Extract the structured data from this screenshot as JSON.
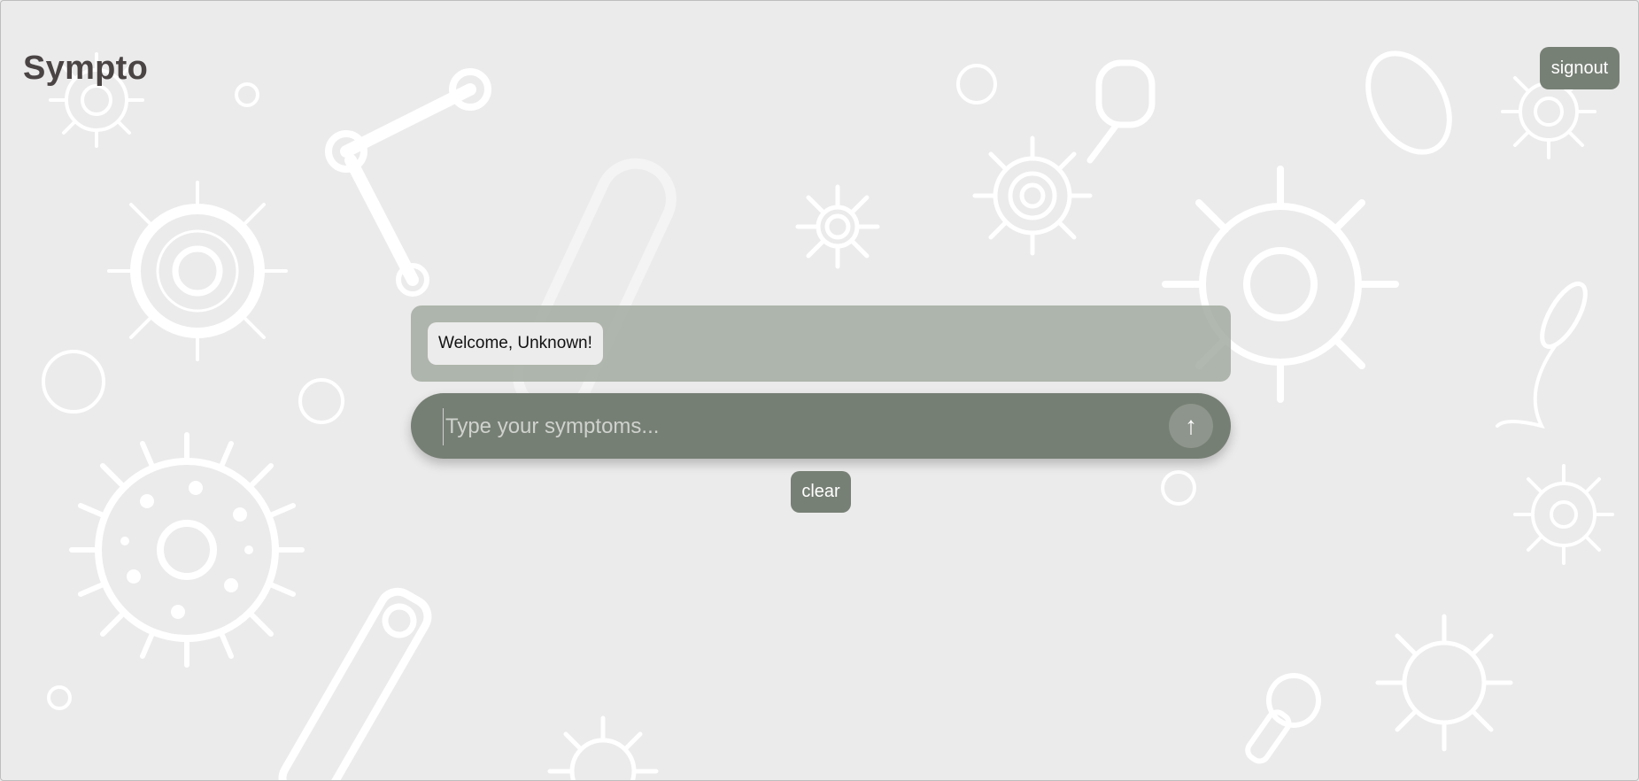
{
  "app": {
    "title": "Sympto"
  },
  "header": {
    "signout_label": "signout"
  },
  "chat": {
    "messages": [
      {
        "text": "Welcome, Unknown!"
      }
    ]
  },
  "input": {
    "placeholder": "Type your symptoms...",
    "value": "",
    "send_icon": "arrow-up-icon",
    "send_glyph": "↑"
  },
  "actions": {
    "clear_label": "clear"
  },
  "colors": {
    "background": "#ebebeb",
    "accent": "#778075",
    "chat_panel": "#a9aea6",
    "bubble": "#ececec",
    "title": "#4a4444"
  }
}
